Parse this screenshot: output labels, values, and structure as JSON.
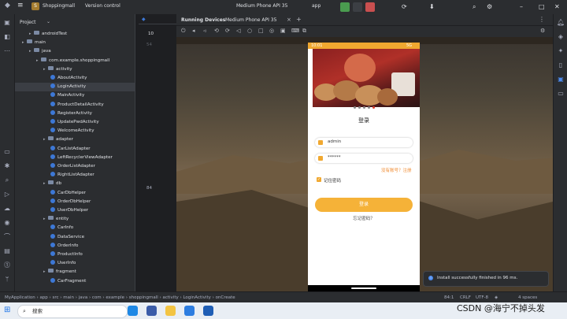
{
  "titlebar": {
    "project_badge": "S",
    "project_name": "Shoppingmall",
    "vcs": "Version control",
    "device": "Medium Phone API 35",
    "run_config": "app"
  },
  "project_panel": {
    "title": "Project",
    "tree": [
      {
        "label": "androidTest",
        "indent": 4,
        "type": "folder"
      },
      {
        "label": "main",
        "indent": 3,
        "type": "folder"
      },
      {
        "label": "java",
        "indent": 4,
        "type": "folder"
      },
      {
        "label": "com.example.shoppingmall",
        "indent": 5,
        "type": "folder"
      },
      {
        "label": "activity",
        "indent": 6,
        "type": "folder"
      },
      {
        "label": "AboutActivity",
        "indent": 7,
        "type": "class"
      },
      {
        "label": "LoginActivity",
        "indent": 7,
        "type": "class"
      },
      {
        "label": "MainActivity",
        "indent": 7,
        "type": "class"
      },
      {
        "label": "ProductDetailActivity",
        "indent": 7,
        "type": "class"
      },
      {
        "label": "RegisterActivity",
        "indent": 7,
        "type": "class"
      },
      {
        "label": "UpdatePwdActivity",
        "indent": 7,
        "type": "class"
      },
      {
        "label": "WelcomeActivity",
        "indent": 7,
        "type": "class"
      },
      {
        "label": "adapter",
        "indent": 6,
        "type": "folder"
      },
      {
        "label": "CarListAdapter",
        "indent": 7,
        "type": "class"
      },
      {
        "label": "LeftRecyclerViewAdapter",
        "indent": 7,
        "type": "class"
      },
      {
        "label": "OrderListAdapter",
        "indent": 7,
        "type": "class"
      },
      {
        "label": "RightListAdapter",
        "indent": 7,
        "type": "class"
      },
      {
        "label": "db",
        "indent": 6,
        "type": "folder"
      },
      {
        "label": "CarDbHelper",
        "indent": 7,
        "type": "class"
      },
      {
        "label": "OrderDbHelper",
        "indent": 7,
        "type": "class"
      },
      {
        "label": "UserDbHelper",
        "indent": 7,
        "type": "class"
      },
      {
        "label": "entity",
        "indent": 6,
        "type": "folder"
      },
      {
        "label": "CarInfo",
        "indent": 7,
        "type": "class"
      },
      {
        "label": "DataService",
        "indent": 7,
        "type": "class"
      },
      {
        "label": "OrderInfo",
        "indent": 7,
        "type": "class"
      },
      {
        "label": "ProductInfo",
        "indent": 7,
        "type": "class"
      },
      {
        "label": "UserInfo",
        "indent": 7,
        "type": "class"
      },
      {
        "label": "fragment",
        "indent": 6,
        "type": "folder"
      },
      {
        "label": "CarFragment",
        "indent": 7,
        "type": "class"
      }
    ]
  },
  "editor": {
    "tab_label": "10",
    "line_numbers": [
      "54",
      "84"
    ]
  },
  "running_devices": {
    "tab": "Running Devices",
    "device_tab": "Medium Phone API 35"
  },
  "phone": {
    "time": "10:01",
    "signal": "5G",
    "title": "登录",
    "username_value": "admin",
    "password_value": "******",
    "register_link": "没有账号？注册",
    "remember_label": "记住密码",
    "login_button": "登录",
    "forgot_link": "忘记密码？"
  },
  "notification": {
    "text": "Install successfully finished in 96 ms."
  },
  "statusbar": {
    "breadcrumb": [
      "MyApplication",
      "app",
      "src",
      "main",
      "java",
      "com",
      "example",
      "shoppingmall",
      "activity",
      "LoginActivity",
      "onCreate"
    ],
    "position": "84:1",
    "line_sep": "CRLF",
    "encoding": "UTF-8",
    "indent": "4 spaces"
  },
  "taskbar": {
    "search_placeholder": "搜索"
  },
  "watermark": "CSDN @海宁不掉头发"
}
